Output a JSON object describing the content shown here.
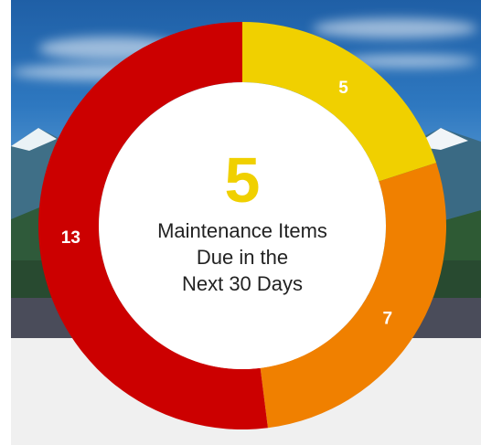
{
  "widget": {
    "count": "5",
    "line1": "Maintenance Items",
    "line2": "Due in the",
    "line3": "Next 30 Days"
  },
  "chart_data": {
    "type": "pie",
    "style": "donut",
    "slices": [
      {
        "value": 5,
        "label": "5",
        "color": "#f0d000"
      },
      {
        "value": 7,
        "label": "7",
        "color": "#f08000"
      },
      {
        "value": 13,
        "label": "13",
        "color": "#cc0000"
      }
    ],
    "center_value": "5",
    "center_text": [
      "Maintenance Items",
      "Due in the",
      "Next 30 Days"
    ]
  },
  "colors": {
    "yellow": "#f0d000",
    "orange": "#f08000",
    "red": "#cc0000",
    "dark_band": "#4a4c5a",
    "light_band": "#f0f0f0"
  }
}
